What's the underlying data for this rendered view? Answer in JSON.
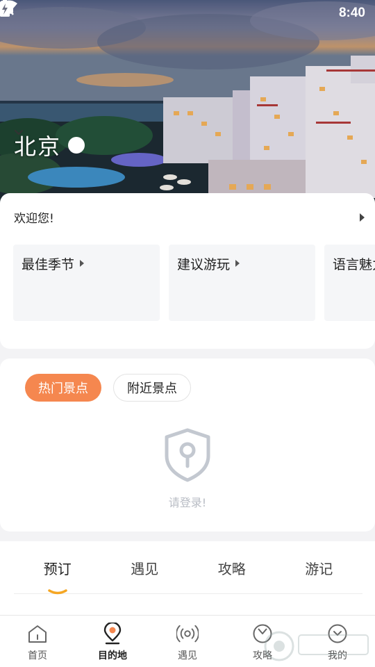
{
  "status_bar": {
    "time": "8:40"
  },
  "hero": {
    "city": "北京"
  },
  "welcome": {
    "greeting": "欢迎您!",
    "tiles": [
      {
        "label": "最佳季节"
      },
      {
        "label": "建议游玩"
      },
      {
        "label": "语言魅力"
      }
    ]
  },
  "attractions": {
    "tabs": [
      {
        "label": "热门景点",
        "active": true
      },
      {
        "label": "附近景点",
        "active": false
      }
    ],
    "empty_text": "请登录!"
  },
  "section_tabs": [
    {
      "label": "预订",
      "active": true
    },
    {
      "label": "遇见",
      "active": false
    },
    {
      "label": "攻略",
      "active": false
    },
    {
      "label": "游记",
      "active": false
    }
  ],
  "bottom_nav": [
    {
      "label": "首页",
      "icon": "home-icon",
      "active": false
    },
    {
      "label": "目的地",
      "icon": "location-pin-icon",
      "active": true
    },
    {
      "label": "遇见",
      "icon": "broadcast-icon",
      "active": false
    },
    {
      "label": "攻略",
      "icon": "compass-icon",
      "active": false
    },
    {
      "label": "我的",
      "icon": "user-icon",
      "active": false
    }
  ],
  "colors": {
    "accent": "#f5874f",
    "underline": "#f5a623",
    "empty_icon": "#c3c8d0"
  }
}
